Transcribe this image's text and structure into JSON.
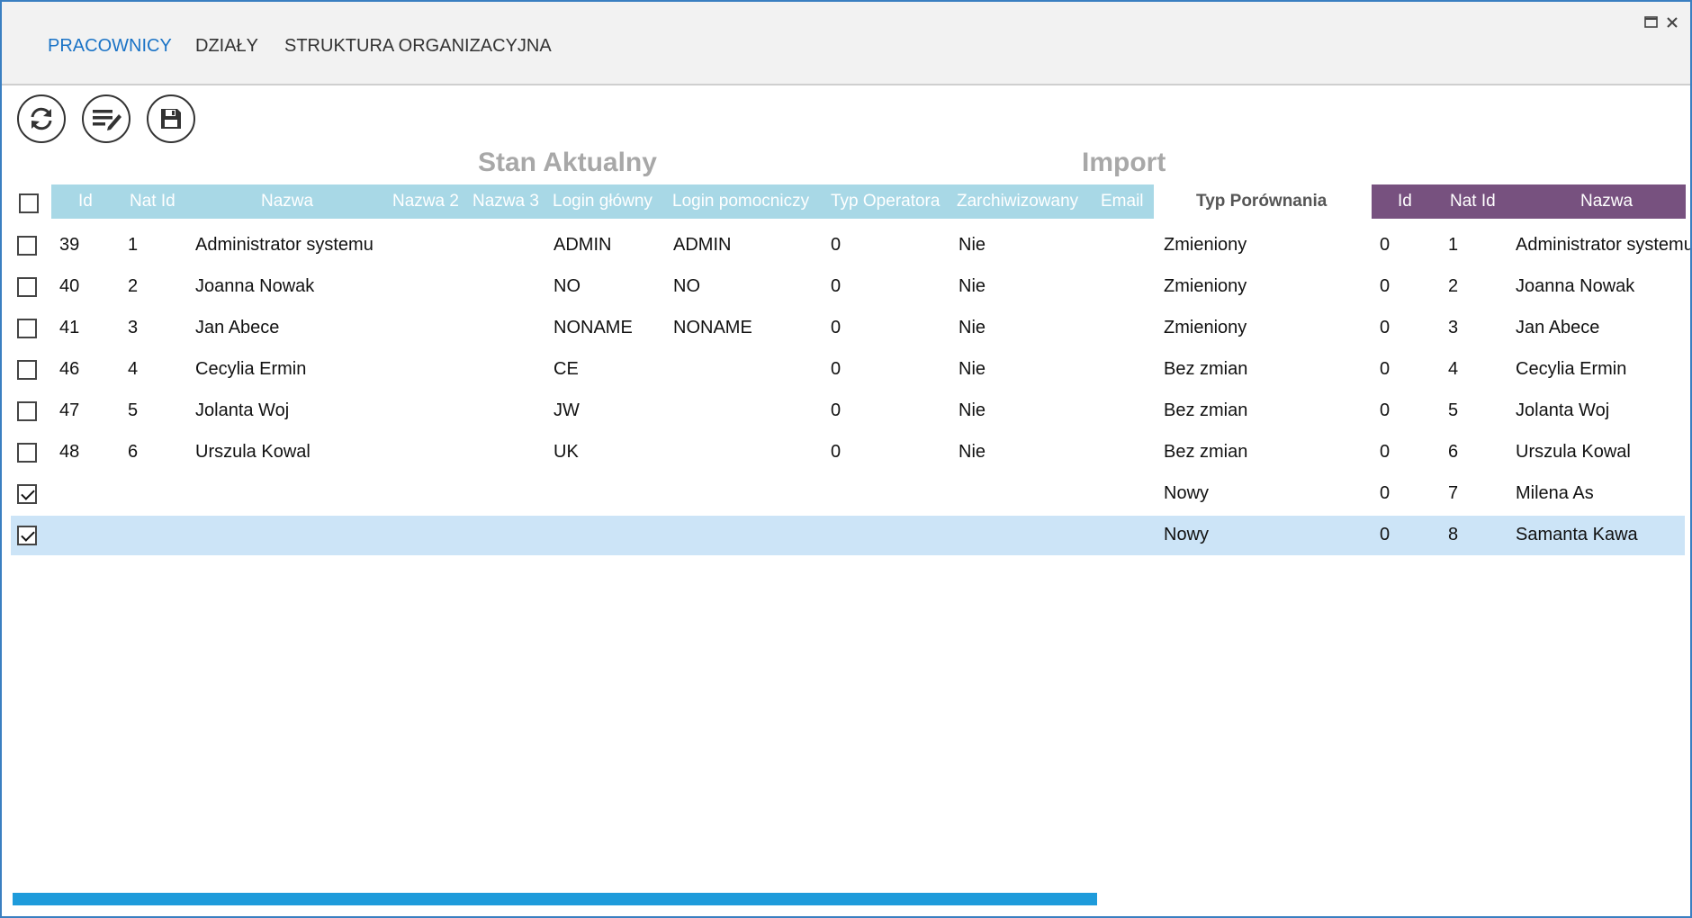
{
  "tabs": [
    {
      "label": "PRACOWNICY",
      "active": true
    },
    {
      "label": "DZIAŁY",
      "active": false
    },
    {
      "label": "STRUKTURA ORGANIZACYJNA",
      "active": false
    }
  ],
  "toolbar": {
    "icons": [
      "refresh-icon",
      "edit-list-icon",
      "save-icon"
    ]
  },
  "sections": {
    "current": "Stan Aktualny",
    "import": "Import"
  },
  "columns": {
    "current": [
      "Id",
      "Nat Id",
      "Nazwa",
      "Nazwa 2",
      "Nazwa 3",
      "Login główny",
      "Login pomocniczy",
      "Typ Operatora",
      "Zarchiwizowany",
      "Email"
    ],
    "compare": "Typ Porównania",
    "import": [
      "Id",
      "Nat Id",
      "Nazwa"
    ]
  },
  "colors": {
    "current_header": "#a8d8e6",
    "import_header": "#77517f",
    "active_tab": "#1a73c6",
    "selected_row": "#cce4f7",
    "scrollbar": "#1e9bdb"
  },
  "rows": [
    {
      "checked": false,
      "id": "39",
      "nat_id": "1",
      "nazwa": "Administrator systemu",
      "login": "ADMIN",
      "login2": "ADMIN",
      "typ": "0",
      "arch": "Nie",
      "cmp": "Zmieniony",
      "imp_id": "0",
      "imp_nat": "1",
      "imp_nazwa": "Administrator systemu"
    },
    {
      "checked": false,
      "id": "40",
      "nat_id": "2",
      "nazwa": "Joanna Nowak",
      "login": "NO",
      "login2": "NO",
      "typ": "0",
      "arch": "Nie",
      "cmp": "Zmieniony",
      "imp_id": "0",
      "imp_nat": "2",
      "imp_nazwa": "Joanna Nowak"
    },
    {
      "checked": false,
      "id": "41",
      "nat_id": "3",
      "nazwa": "Jan Abece",
      "login": "NONAME",
      "login2": "NONAME",
      "typ": "0",
      "arch": "Nie",
      "cmp": "Zmieniony",
      "imp_id": "0",
      "imp_nat": "3",
      "imp_nazwa": "Jan Abece"
    },
    {
      "checked": false,
      "id": "46",
      "nat_id": "4",
      "nazwa": "Cecylia Ermin",
      "login": "CE",
      "login2": "",
      "typ": "0",
      "arch": "Nie",
      "cmp": "Bez zmian",
      "imp_id": "0",
      "imp_nat": "4",
      "imp_nazwa": "Cecylia Ermin"
    },
    {
      "checked": false,
      "id": "47",
      "nat_id": "5",
      "nazwa": "Jolanta Woj",
      "login": "JW",
      "login2": "",
      "typ": "0",
      "arch": "Nie",
      "cmp": "Bez zmian",
      "imp_id": "0",
      "imp_nat": "5",
      "imp_nazwa": "Jolanta Woj"
    },
    {
      "checked": false,
      "id": "48",
      "nat_id": "6",
      "nazwa": "Urszula Kowal",
      "login": "UK",
      "login2": "",
      "typ": "0",
      "arch": "Nie",
      "cmp": "Bez zmian",
      "imp_id": "0",
      "imp_nat": "6",
      "imp_nazwa": "Urszula Kowal"
    },
    {
      "checked": true,
      "id": "",
      "nat_id": "",
      "nazwa": "",
      "login": "",
      "login2": "",
      "typ": "",
      "arch": "",
      "cmp": "Nowy",
      "imp_id": "0",
      "imp_nat": "7",
      "imp_nazwa": "Milena As"
    },
    {
      "checked": true,
      "selected": true,
      "id": "",
      "nat_id": "",
      "nazwa": "",
      "login": "",
      "login2": "",
      "typ": "",
      "arch": "",
      "cmp": "Nowy",
      "imp_id": "0",
      "imp_nat": "8",
      "imp_nazwa": "Samanta Kawa"
    }
  ]
}
